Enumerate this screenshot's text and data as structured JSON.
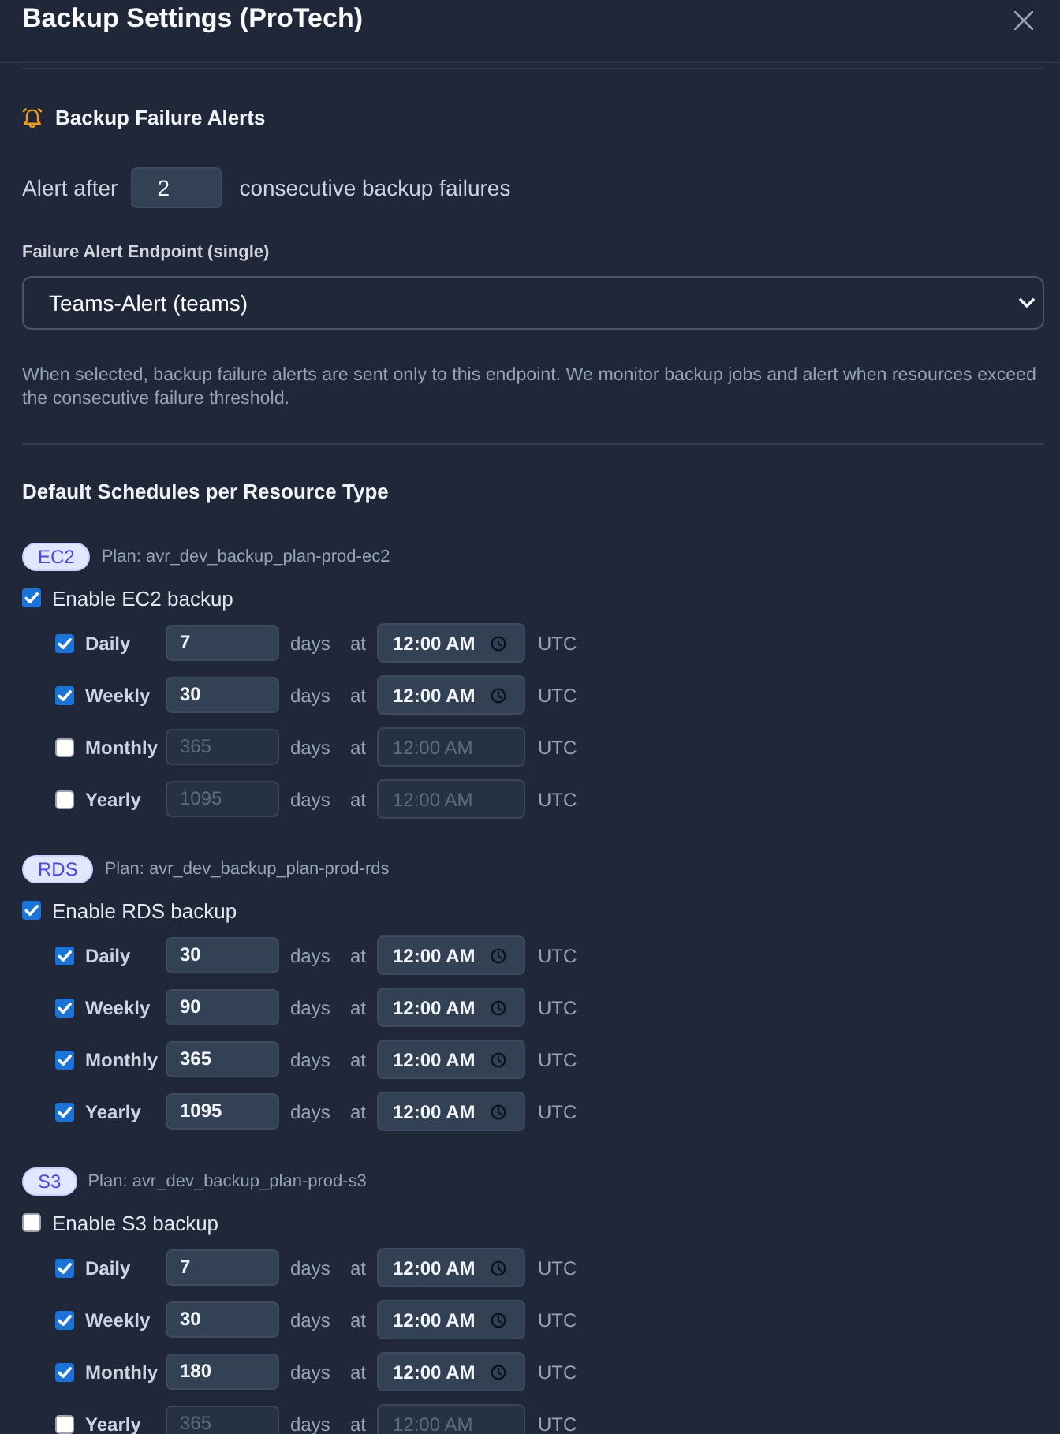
{
  "dialog": {
    "title": "Backup Settings (ProTech)"
  },
  "alerts": {
    "heading": "Backup Failure Alerts",
    "threshold_prefix": "Alert after",
    "threshold": "2",
    "threshold_suffix": "consecutive backup failures",
    "endpoint_label": "Failure Alert Endpoint (single)",
    "endpoint": "Teams-Alert (teams)",
    "help": "When selected, backup failure alerts are sent only to this endpoint. We monitor backup jobs and alert when resources exceed the consecutive failure threshold."
  },
  "schedules": {
    "heading": "Default Schedules per Resource Type",
    "resources": [
      {
        "badge": "EC2",
        "plan": "Plan: avr_dev_backup_plan-prod-ec2",
        "enable_label": "Enable EC2 backup",
        "checked": true,
        "rows": [
          {
            "label": "Daily",
            "checked": true,
            "days": "7",
            "unit": "days",
            "at": "at",
            "time": "12:00 AM",
            "zone": "UTC"
          },
          {
            "label": "Weekly",
            "checked": true,
            "days": "30",
            "unit": "days",
            "at": "at",
            "time": "12:00 AM",
            "zone": "UTC"
          },
          {
            "label": "Monthly",
            "checked": false,
            "days": "365",
            "unit": "days",
            "at": "at",
            "time": "12:00 AM",
            "zone": "UTC"
          },
          {
            "label": "Yearly",
            "checked": false,
            "days": "1095",
            "unit": "days",
            "at": "at",
            "time": "12:00 AM",
            "zone": "UTC"
          }
        ]
      },
      {
        "badge": "RDS",
        "plan": "Plan: avr_dev_backup_plan-prod-rds",
        "enable_label": "Enable RDS backup",
        "checked": true,
        "rows": [
          {
            "label": "Daily",
            "checked": true,
            "days": "30",
            "unit": "days",
            "at": "at",
            "time": "12:00 AM",
            "zone": "UTC"
          },
          {
            "label": "Weekly",
            "checked": true,
            "days": "90",
            "unit": "days",
            "at": "at",
            "time": "12:00 AM",
            "zone": "UTC"
          },
          {
            "label": "Monthly",
            "checked": true,
            "days": "365",
            "unit": "days",
            "at": "at",
            "time": "12:00 AM",
            "zone": "UTC"
          },
          {
            "label": "Yearly",
            "checked": true,
            "days": "1095",
            "unit": "days",
            "at": "at",
            "time": "12:00 AM",
            "zone": "UTC"
          }
        ]
      },
      {
        "badge": "S3",
        "plan": "Plan: avr_dev_backup_plan-prod-s3",
        "enable_label": "Enable S3 backup",
        "checked": false,
        "rows": [
          {
            "label": "Daily",
            "checked": true,
            "days": "7",
            "unit": "days",
            "at": "at",
            "time": "12:00 AM",
            "zone": "UTC"
          },
          {
            "label": "Weekly",
            "checked": true,
            "days": "30",
            "unit": "days",
            "at": "at",
            "time": "12:00 AM",
            "zone": "UTC"
          },
          {
            "label": "Monthly",
            "checked": true,
            "days": "180",
            "unit": "days",
            "at": "at",
            "time": "12:00 AM",
            "zone": "UTC"
          },
          {
            "label": "Yearly",
            "checked": false,
            "days": "365",
            "unit": "days",
            "at": "at",
            "time": "12:00 AM",
            "zone": "UTC"
          }
        ]
      }
    ]
  }
}
